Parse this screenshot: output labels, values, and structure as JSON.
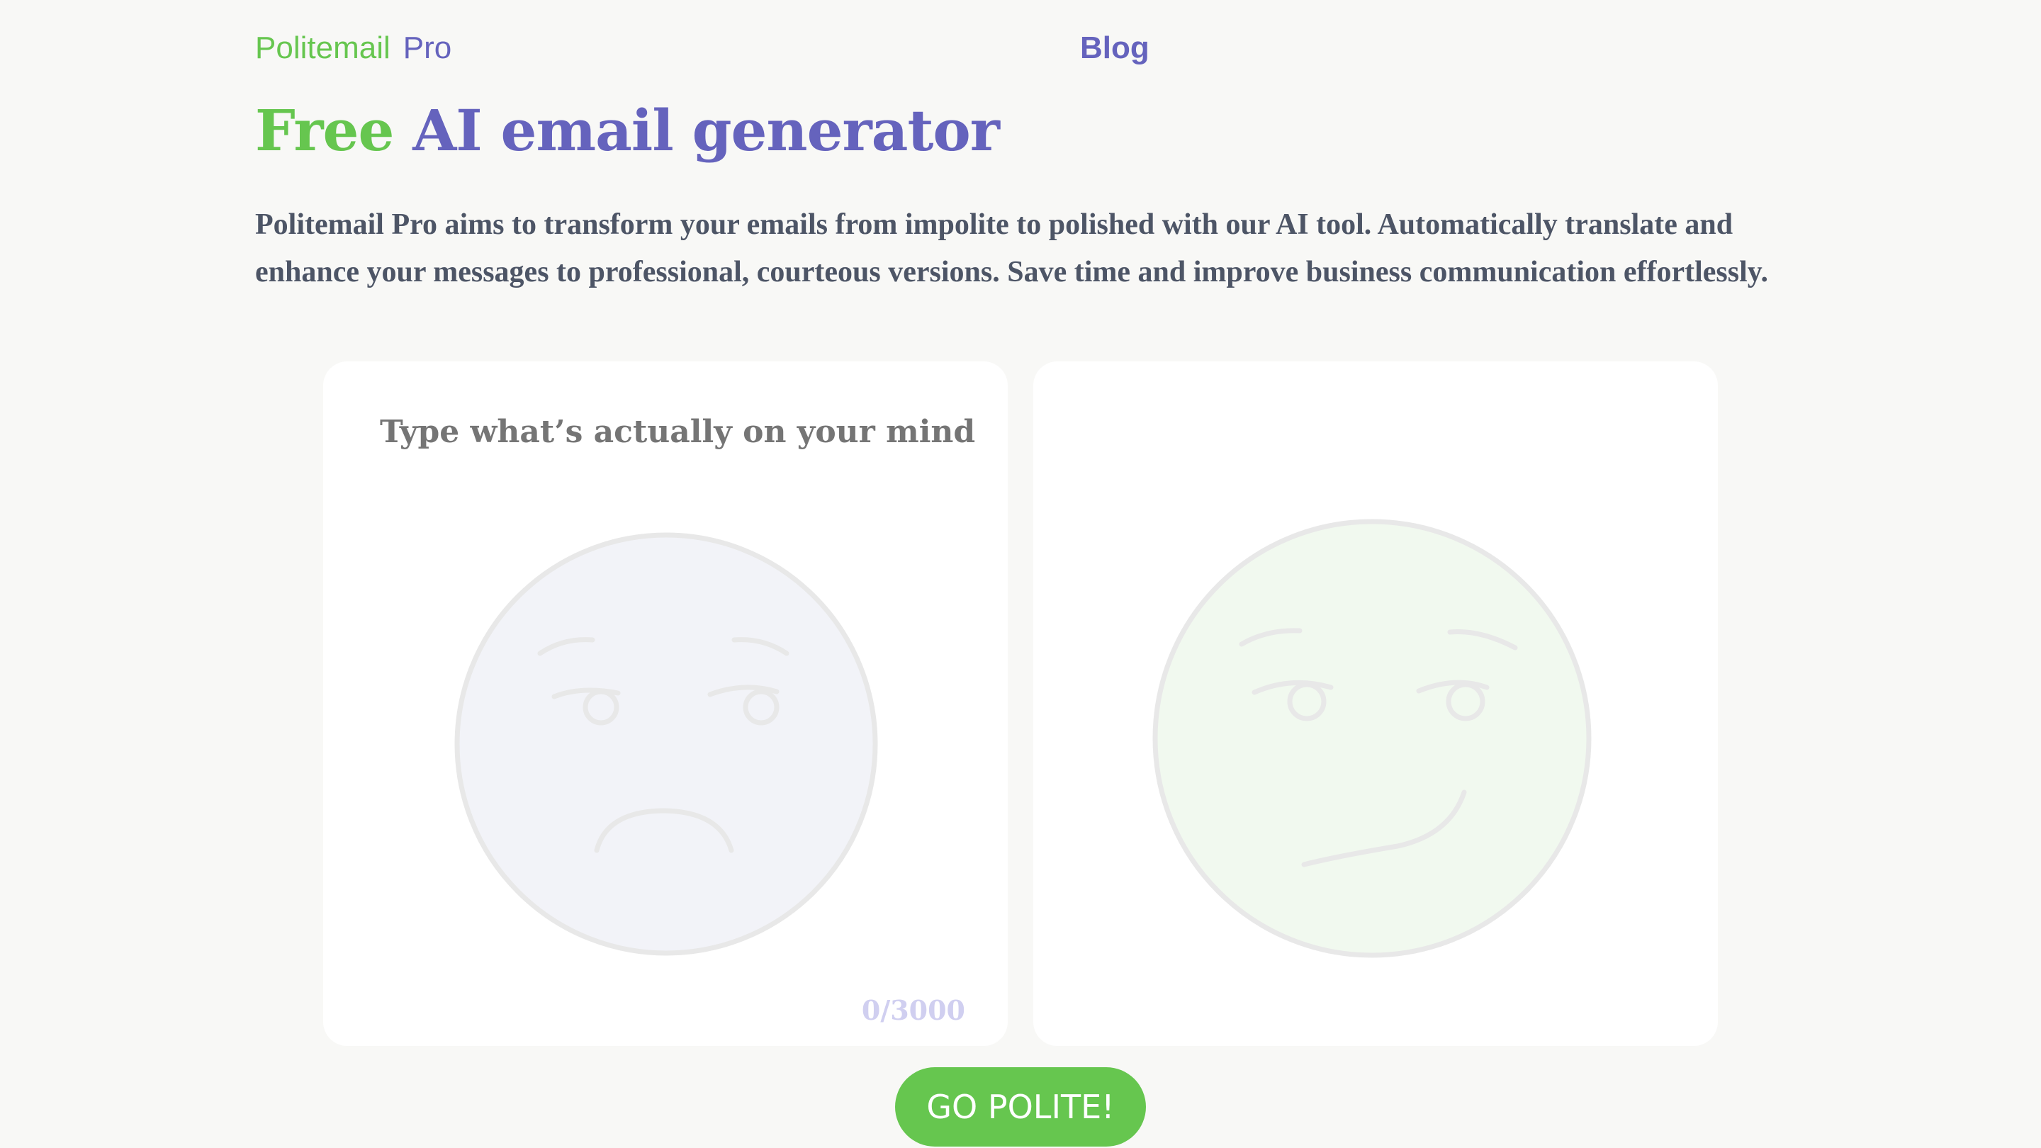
{
  "header": {
    "logo_part1": "Politemail",
    "logo_part2": "Pro",
    "nav_blog": "Blog"
  },
  "hero": {
    "title_highlight": "Free",
    "title_rest": "AI email generator",
    "description": "Politemail Pro aims to transform your emails from impolite to polished with our AI tool. Automatically translate and enhance your messages to professional, courteous versions. Save time and improve business communication effortlessly."
  },
  "input_panel": {
    "placeholder": "Type what’s actually on your mind...",
    "value": "",
    "char_count": "0/3000",
    "face_icon": "sad-face-icon"
  },
  "output_panel": {
    "face_icon": "smirk-face-icon"
  },
  "actions": {
    "go_label": "GO POLITE!"
  },
  "colors": {
    "background": "#f8f8f6",
    "brand_green": "#66c64f",
    "brand_purple": "#6563bd",
    "body_text": "#4d5566",
    "placeholder": "#c9c6ee",
    "sad_face_fill": "#f2f3f8",
    "smirk_face_fill": "#f1f9ef",
    "face_stroke": "#e8e8e8"
  }
}
